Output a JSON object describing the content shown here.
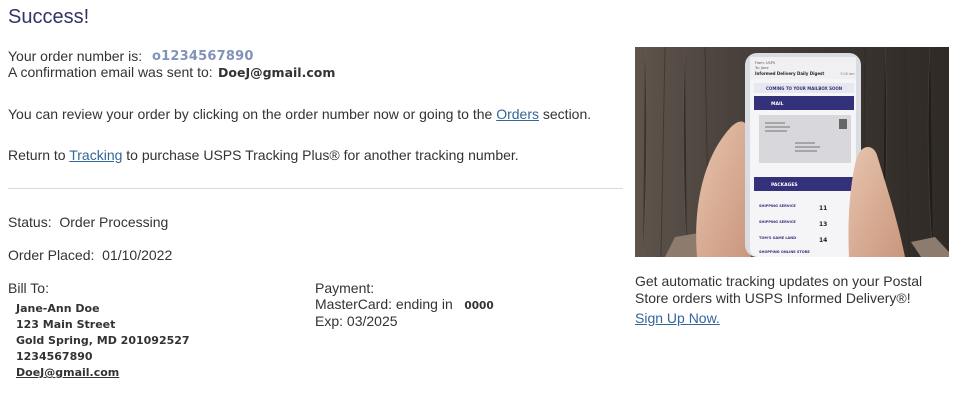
{
  "heading": "Success!",
  "order": {
    "number_label": "Your order number is:",
    "number": "o1234567890",
    "email_label": "A confirmation email was sent to:",
    "email": "DoeJ@gmail.com"
  },
  "review": {
    "prefix": "You can review your order by clicking on the order number now or going to the ",
    "link": "Orders",
    "suffix": " section."
  },
  "return_line": {
    "prefix": "Return to ",
    "link": "Tracking",
    "suffix": " to purchase USPS Tracking Plus® for another tracking number."
  },
  "status": {
    "label": "Status:",
    "value": "Order Processing"
  },
  "placed": {
    "label": "Order Placed:",
    "value": "01/10/2022"
  },
  "bill_to": {
    "label": "Bill To:",
    "name": "Jane-Ann Doe",
    "street": "123 Main Street",
    "city": "Gold Spring, MD 201092527",
    "phone": "1234567890",
    "email": "DoeJ@gmail.com"
  },
  "payment": {
    "label": "Payment:",
    "card": "MasterCard: ending in",
    "last4": "0000",
    "exp": "Exp: 03/2025"
  },
  "promo": {
    "text": "Get automatic tracking updates on your Postal Store orders with USPS Informed Delivery®!",
    "link": "Sign Up Now.",
    "phone_screen": {
      "from": "From: USPS",
      "to": "To: Jane",
      "subject": "Informed Delivery Daily Digest",
      "time": "7:00 am",
      "banner": "COMING TO YOUR MAILBOX SOON",
      "mail_header": "MAIL",
      "packages_header": "PACKAGES",
      "packages": [
        {
          "label": "SHIPPING SERVICE",
          "value": "11"
        },
        {
          "label": "SHIPPING SERVICE",
          "value": "13"
        },
        {
          "label": "TOM'S GAME LAND",
          "value": "14"
        },
        {
          "label": "SHOPPING ONLINE STORE",
          "value": ""
        }
      ]
    },
    "colors": {
      "phone_navy": "#33317a",
      "wood_dark": "#3a3430",
      "wood_light": "#6d6259"
    }
  }
}
